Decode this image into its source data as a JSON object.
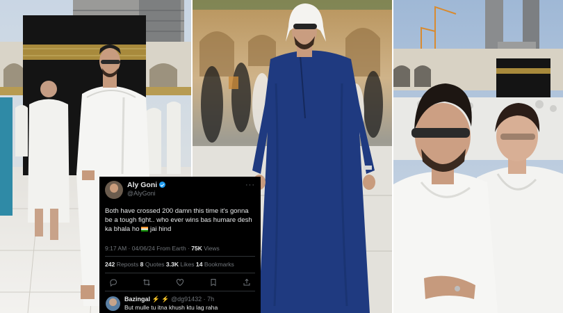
{
  "tweet": {
    "name": "Aly Goni",
    "handle": "@AlyGoni",
    "more": "···",
    "text": "Both have crossed 200 damn this time it's gonna be a tough fight.. who ever wins bas humare desh ka bhala ho",
    "text_suffix": " jai hind",
    "flag_icon": "india-flag-emoji",
    "time_date": "9:17 AM · 04/06/24 From Earth · ",
    "views_count": "75K",
    "views_label": " Views",
    "reposts_count": "242",
    "reposts_label": " Reposts  ",
    "quotes_count": "8",
    "quotes_label": " Quotes  ",
    "likes_count": "3.3K",
    "likes_label": " Likes  ",
    "bookmarks_count": "14",
    "bookmarks_label": " Bookmarks",
    "actions": [
      "reply-icon",
      "repost-icon",
      "like-icon",
      "bookmark-icon",
      "share-icon"
    ]
  },
  "reply": {
    "name": "Bazingal",
    "badges": " ⚡ ⚡ ",
    "handle_time": "@dg91432 · 7h",
    "text": "But mulle tu itna khush ktu lag raha"
  },
  "colors": {
    "card_bg": "#000000",
    "text_primary": "#e7e9ea",
    "text_secondary": "#71767b",
    "divider": "#2f3336",
    "verified": "#1d9bf0",
    "kaaba": "#141414",
    "kaaba_band": "#a88a3c",
    "ihram": "#f4f4f2",
    "thobe": "#1f3a80"
  }
}
